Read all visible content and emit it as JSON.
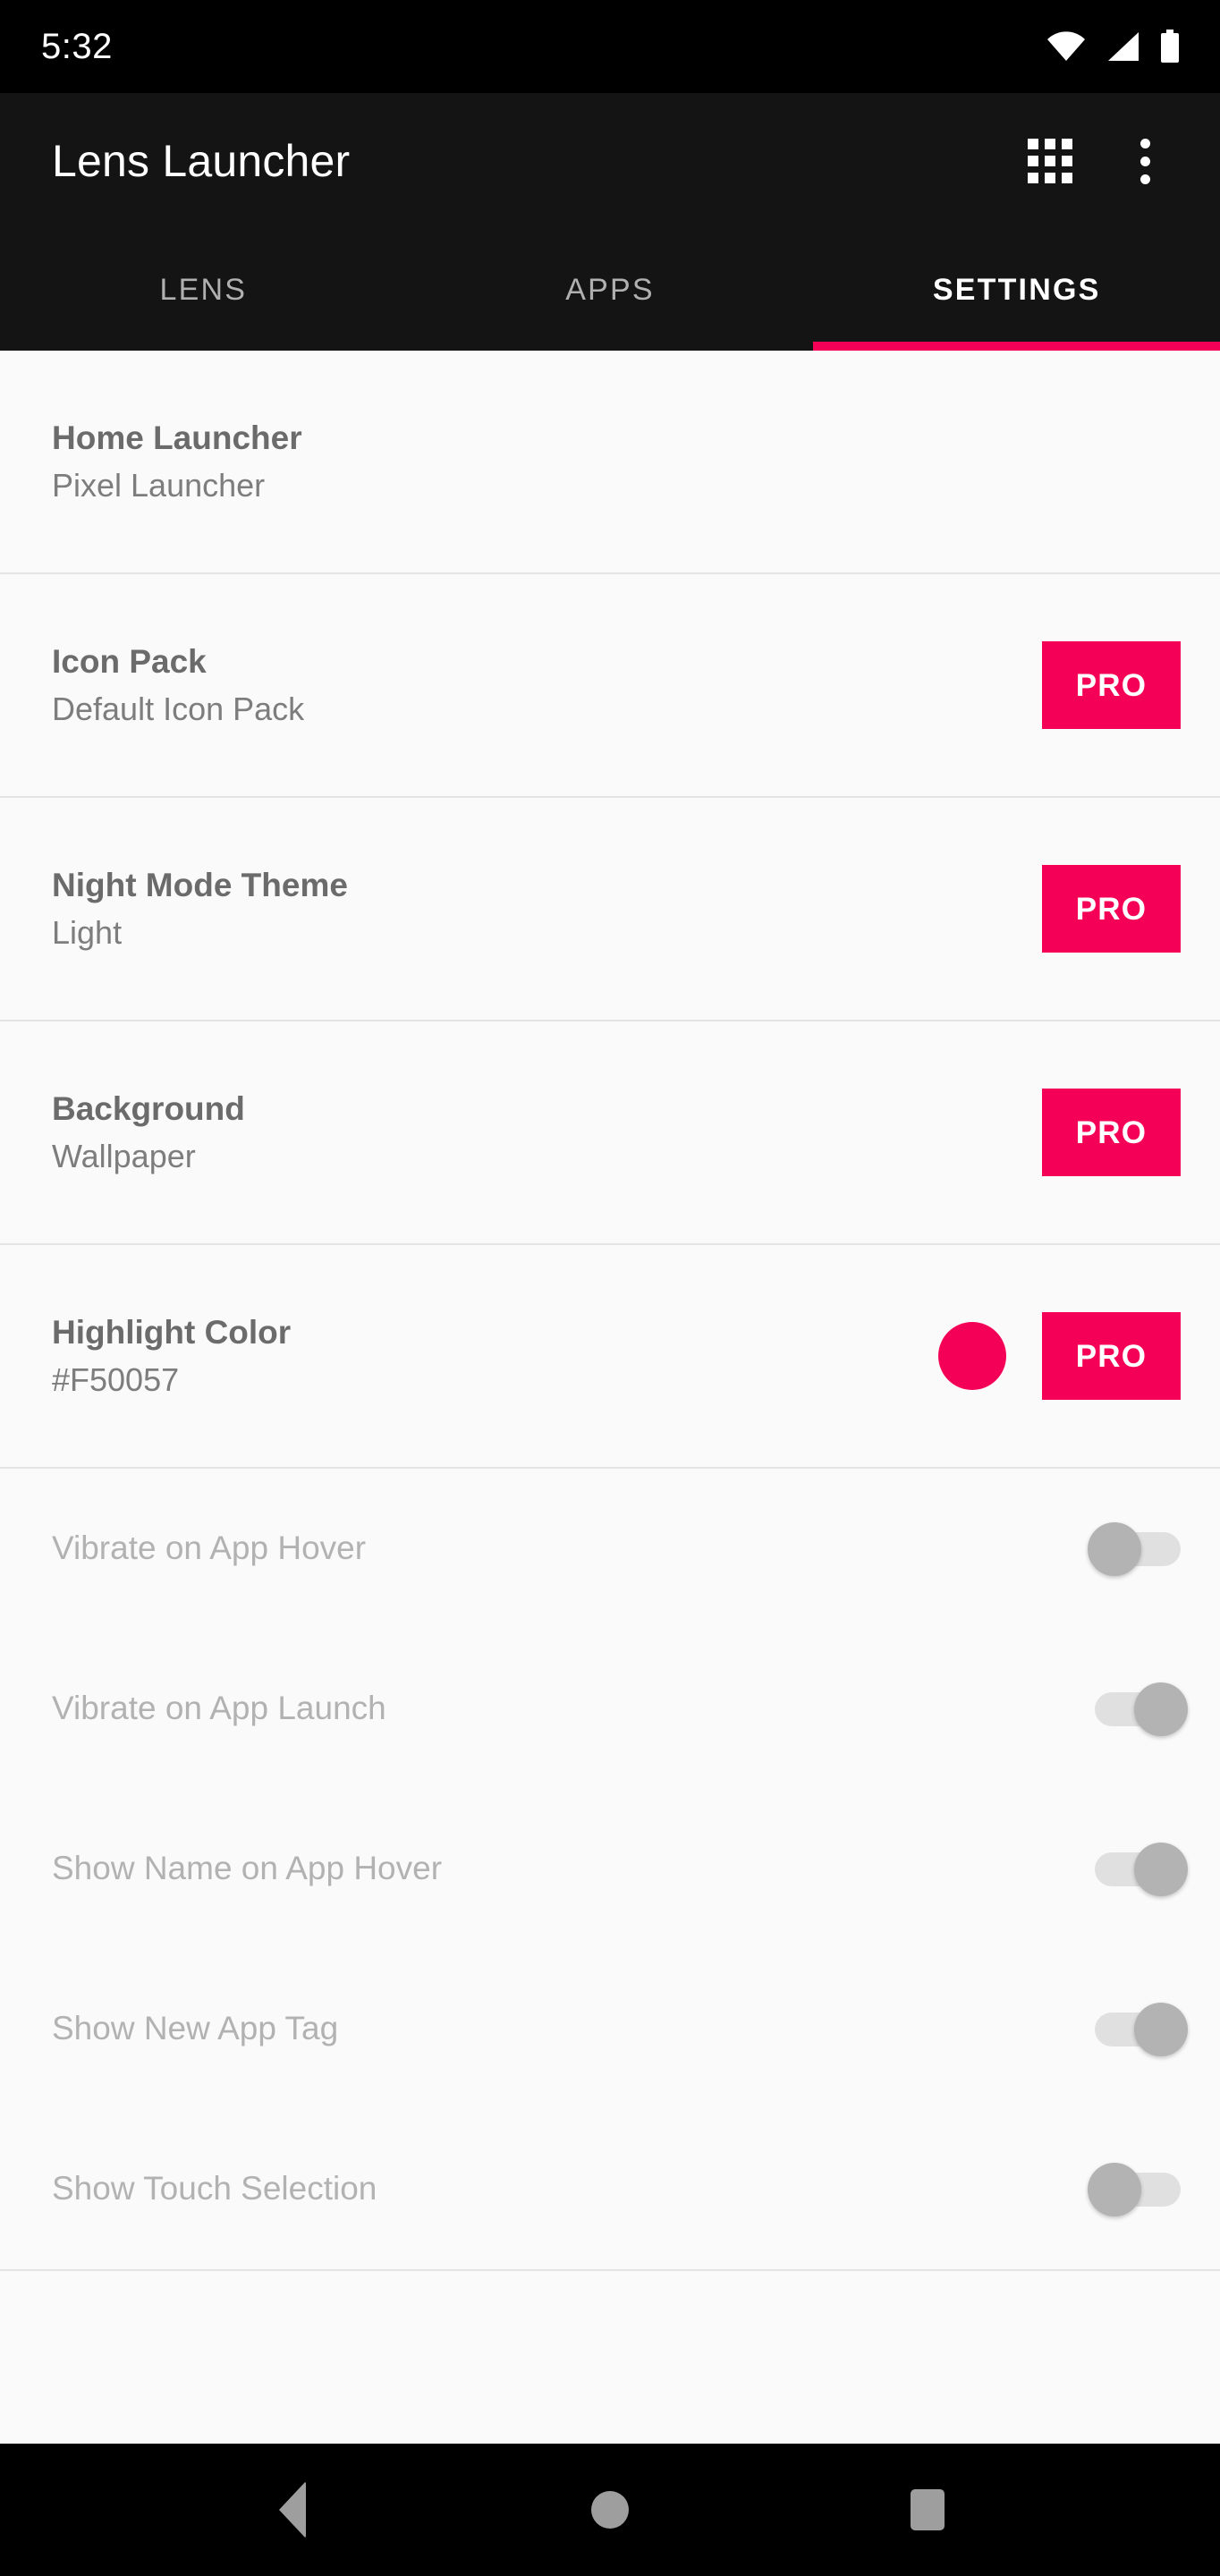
{
  "status_bar": {
    "time": "5:32",
    "icons": [
      "wifi-icon",
      "cellular-signal-icon",
      "battery-icon"
    ]
  },
  "toolbar": {
    "title": "Lens Launcher",
    "actions": [
      {
        "name": "apps-grid-icon",
        "label": "Apps Grid"
      },
      {
        "name": "overflow-menu-icon",
        "label": "More options"
      }
    ]
  },
  "tabs": {
    "active_index": 2,
    "items": [
      {
        "label": "LENS"
      },
      {
        "label": "APPS"
      },
      {
        "label": "SETTINGS"
      }
    ],
    "indicator_color": "#F50057"
  },
  "settings": {
    "preferences": [
      {
        "title": "Home Launcher",
        "summary": "Pixel Launcher",
        "pro": false,
        "pro_label": ""
      },
      {
        "title": "Icon Pack",
        "summary": "Default Icon Pack",
        "pro": true,
        "pro_label": "PRO"
      },
      {
        "title": "Night Mode Theme",
        "summary": "Light",
        "pro": true,
        "pro_label": "PRO"
      },
      {
        "title": "Background",
        "summary": "Wallpaper",
        "pro": true,
        "pro_label": "PRO"
      },
      {
        "title": "Highlight Color",
        "summary": "#F50057",
        "pro": true,
        "pro_label": "PRO",
        "swatch_color": "#F50057"
      }
    ],
    "switches": [
      {
        "title": "Vibrate on App Hover",
        "checked": false
      },
      {
        "title": "Vibrate on App Launch",
        "checked": true
      },
      {
        "title": "Show Name on App Hover",
        "checked": true
      },
      {
        "title": "Show New App Tag",
        "checked": true
      },
      {
        "title": "Show Touch Selection",
        "checked": false
      }
    ]
  },
  "nav_bar": {
    "buttons": [
      {
        "name": "back-button",
        "label": "Back"
      },
      {
        "name": "home-button",
        "label": "Home"
      },
      {
        "name": "recents-button",
        "label": "Recents"
      }
    ]
  }
}
